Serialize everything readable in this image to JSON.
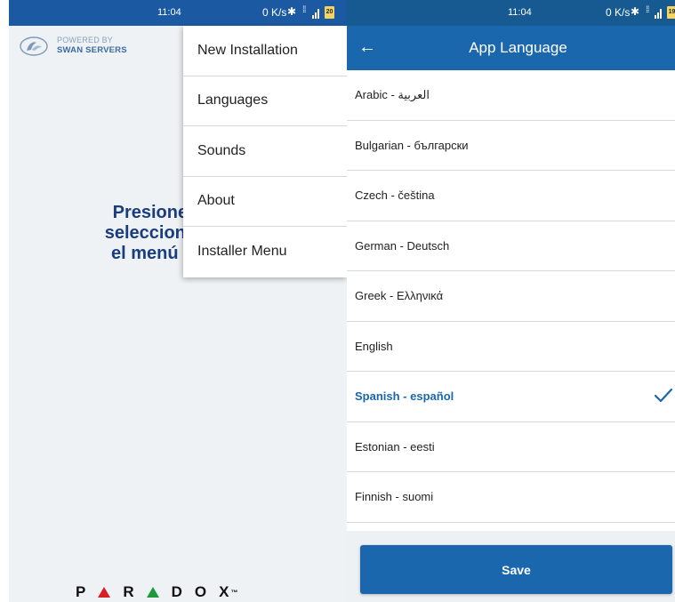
{
  "left": {
    "status": {
      "time": "11:04",
      "speed": "0 K/s",
      "battery": "20"
    },
    "logo": {
      "powered_by": "POWERED BY",
      "brand": "SWAN SERVERS"
    },
    "message_lines": [
      "Presione, para ag",
      "seleccione una nue",
      "el menú para crea"
    ],
    "menu_items": [
      {
        "label": "New Installation"
      },
      {
        "label": "Languages"
      },
      {
        "label": "Sounds"
      },
      {
        "label": "About"
      },
      {
        "label": "Installer Menu"
      }
    ],
    "paradox_letters": [
      "P",
      "R",
      "D",
      "O",
      "X"
    ],
    "paradox_tm": "™"
  },
  "right": {
    "status": {
      "time": "11:04",
      "speed": "0 K/s",
      "battery": "19"
    },
    "app_bar": {
      "title": "App Language"
    },
    "languages": [
      {
        "label": "Arabic - العربية",
        "selected": false
      },
      {
        "label": "Bulgarian - български",
        "selected": false
      },
      {
        "label": "Czech - čeština",
        "selected": false
      },
      {
        "label": "German - Deutsch",
        "selected": false
      },
      {
        "label": "Greek - Ελληνικά",
        "selected": false
      },
      {
        "label": "English",
        "selected": false
      },
      {
        "label": "Spanish - español",
        "selected": true
      },
      {
        "label": "Estonian - eesti",
        "selected": false
      },
      {
        "label": "Finnish - suomi",
        "selected": false
      }
    ],
    "save_label": "Save"
  },
  "colors": {
    "primary": "#1b67ae",
    "message_text": "#1a3d80",
    "paradox_red": "#d91f26",
    "paradox_green": "#1e9a3c"
  }
}
